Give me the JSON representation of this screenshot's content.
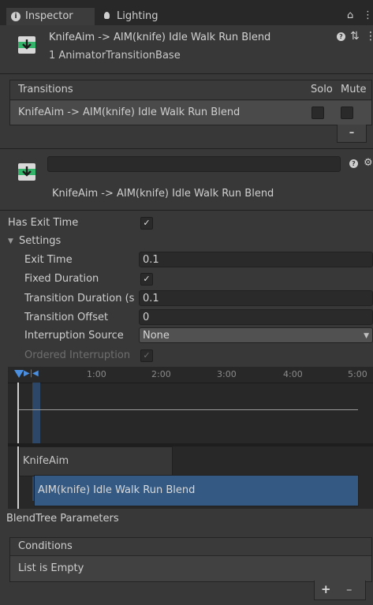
{
  "tabs": [
    {
      "label": "Inspector"
    },
    {
      "label": "Lighting"
    }
  ],
  "header": {
    "title": "KnifeAim -> AIM(knife) Idle Walk Run Blend",
    "subtitle": "1 AnimatorTransitionBase"
  },
  "transitions": {
    "label": "Transitions",
    "solo_label": "Solo",
    "mute_label": "Mute",
    "rows": [
      {
        "name": "KnifeAim -> AIM(knife) Idle Walk Run Blend"
      }
    ],
    "remove_label": "–"
  },
  "transition": {
    "name_value": "",
    "title": "KnifeAim -> AIM(knife) Idle Walk Run Blend"
  },
  "props": {
    "has_exit_time": "Has Exit Time",
    "settings": "Settings",
    "exit_time_label": "Exit Time",
    "exit_time_value": "0.1",
    "fixed_duration_label": "Fixed Duration",
    "transition_duration_label": "Transition Duration (s",
    "transition_duration_value": "0.1",
    "transition_offset_label": "Transition Offset",
    "transition_offset_value": "0",
    "interruption_source_label": "Interruption Source",
    "interruption_source_value": "None",
    "ordered_interruption_label": "Ordered Interruption"
  },
  "timeline": {
    "ticks": [
      "1:00",
      "2:00",
      "3:00",
      "4:00",
      "5:00"
    ],
    "bar1": "KnifeAim",
    "bar2": "AIM(knife) Idle Walk Run Blend"
  },
  "blendtree": {
    "label": "BlendTree Parameters"
  },
  "conditions": {
    "label": "Conditions",
    "empty": "List is Empty",
    "add": "+",
    "remove": "–"
  }
}
